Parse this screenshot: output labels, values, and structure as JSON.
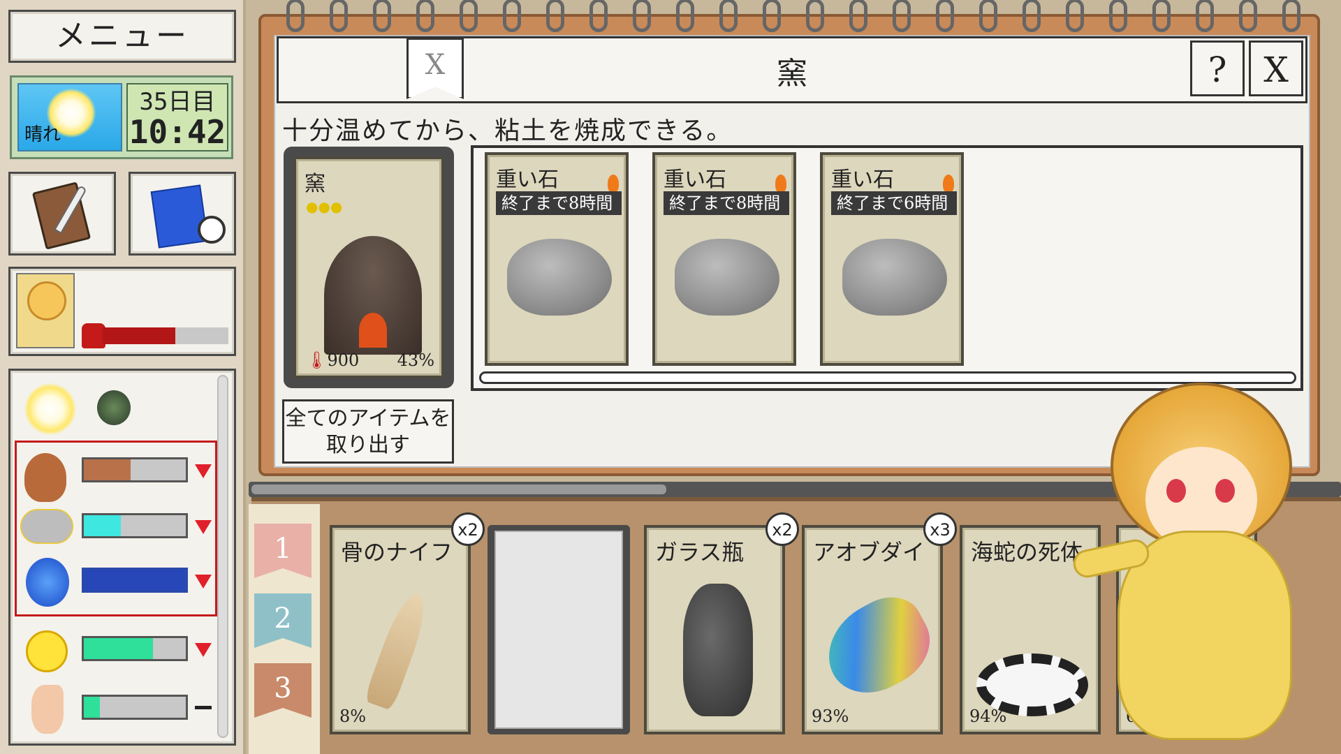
{
  "sidebar": {
    "menu_label": "メニュー",
    "weather_label": "晴れ",
    "day": "35日目",
    "time": "10:42"
  },
  "kiln": {
    "title": "窯",
    "help_label": "?",
    "close_label": "X",
    "bookmark_label": "X",
    "description": "十分温めてから、粘土を焼成できる。",
    "card_name": "窯",
    "temperature": "900",
    "progress": "43%",
    "take_all_label": "全てのアイテムを取り出す",
    "slots": [
      {
        "name": "重い石",
        "timer": "終了まで8時間"
      },
      {
        "name": "重い石",
        "timer": "終了まで8時間"
      },
      {
        "name": "重い石",
        "timer": "終了まで6時間"
      }
    ]
  },
  "inventory": {
    "tabs": [
      "1",
      "2",
      "3"
    ],
    "items": [
      {
        "name": "骨のナイフ",
        "count": "x2",
        "durability": "8%"
      },
      {
        "name": "",
        "count": "",
        "durability": ""
      },
      {
        "name": "ガラス瓶",
        "count": "x2",
        "durability": ""
      },
      {
        "name": "アオブダイ",
        "count": "x3",
        "durability": "93%"
      },
      {
        "name": "海蛇の死体",
        "count": "",
        "durability": "94%"
      },
      {
        "name": "",
        "count": "",
        "durability": "66%"
      }
    ]
  },
  "colors": {
    "hunger": "#b9714a",
    "thirst": "#3ee8e0",
    "water": "#2747b8",
    "mood": "#2ee09a",
    "smell": "#2ee09a",
    "weight": "#b31616"
  },
  "icons": [
    "sun-icon",
    "fly-icon",
    "chicken-leg-icon",
    "cloud-icon",
    "water-drop-icon",
    "smiley-icon",
    "nose-icon",
    "journal-icon",
    "blueprint-icon",
    "alarm-clock-icon",
    "weight-icon"
  ]
}
